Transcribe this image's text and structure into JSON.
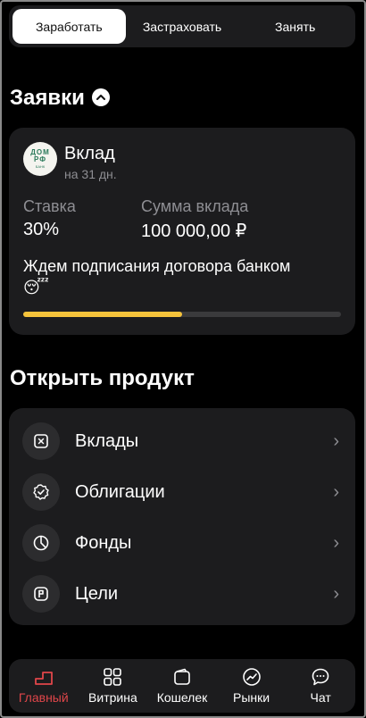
{
  "tabs": [
    {
      "label": "Заработать",
      "active": true
    },
    {
      "label": "Застраховать",
      "active": false
    },
    {
      "label": "Занять",
      "active": false
    }
  ],
  "applications": {
    "title": "Заявки",
    "card": {
      "logo_text": [
        "ДОМ",
        "РФ",
        "БАНК"
      ],
      "product": "Вклад",
      "term": "на 31 дн.",
      "rate_label": "Ставка",
      "rate_value": "30%",
      "amount_label": "Сумма вклада",
      "amount_value": "100 000,00 ₽",
      "status_text": "Ждем подписания договора банком",
      "status_emoji": "😴",
      "progress": 0.5
    }
  },
  "open_product": {
    "title": "Открыть продукт",
    "items": [
      {
        "label": "Вклады",
        "icon": "deposit-icon"
      },
      {
        "label": "Облигации",
        "icon": "bond-icon"
      },
      {
        "label": "Фонды",
        "icon": "fund-icon"
      },
      {
        "label": "Цели",
        "icon": "goal-icon"
      }
    ]
  },
  "bottom_nav": [
    {
      "label": "Главный",
      "icon": "home-icon",
      "active": true
    },
    {
      "label": "Витрина",
      "icon": "showcase-icon",
      "active": false
    },
    {
      "label": "Кошелек",
      "icon": "wallet-icon",
      "active": false
    },
    {
      "label": "Рынки",
      "icon": "markets-icon",
      "active": false
    },
    {
      "label": "Чат",
      "icon": "chat-icon",
      "active": false
    }
  ],
  "colors": {
    "background": "#000000",
    "card": "#1c1c1e",
    "progress": "#f5c33b",
    "active_nav": "#e0464a"
  }
}
